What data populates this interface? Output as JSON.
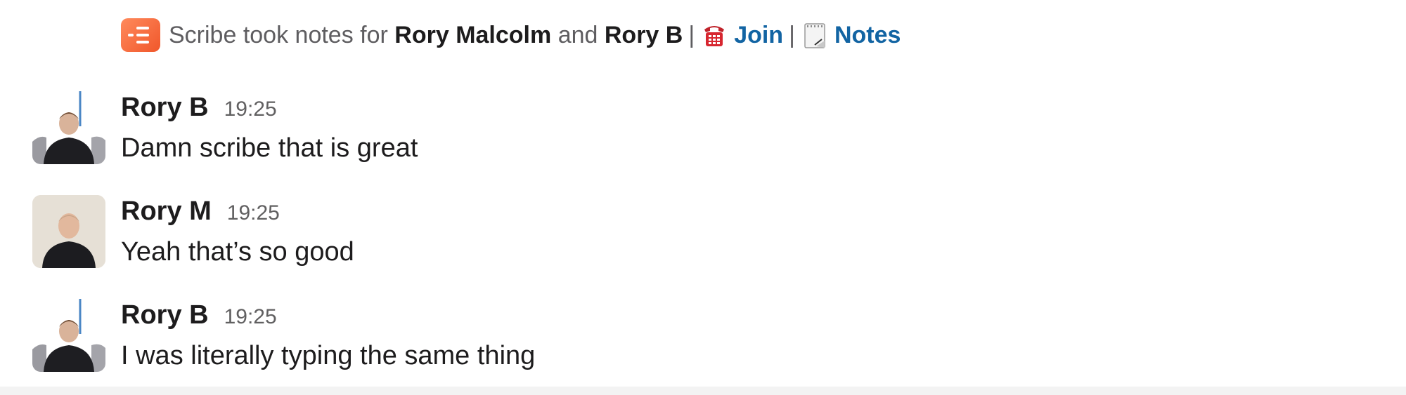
{
  "scribe": {
    "prefix": "Scribe took notes for",
    "name1": "Rory Malcolm",
    "and": "and",
    "name2": "Rory B",
    "sep1": "|",
    "join_label": "Join",
    "sep2": "|",
    "notes_label": "Notes",
    "logo_icon": "scribe-logo-icon",
    "join_icon": "telephone-icon",
    "notes_icon": "notepad-icon"
  },
  "messages": [
    {
      "sender": "Rory B",
      "time": "19:25",
      "text": "Damn scribe that is great"
    },
    {
      "sender": "Rory M",
      "time": "19:25",
      "text": "Yeah that’s so good"
    },
    {
      "sender": "Rory B",
      "time": "19:25",
      "text": "I was literally typing the same thing"
    }
  ],
  "colors": {
    "link": "#1264a3",
    "scribe_brand": "#f0572b",
    "text": "#1d1c1d",
    "muted": "#616061"
  }
}
